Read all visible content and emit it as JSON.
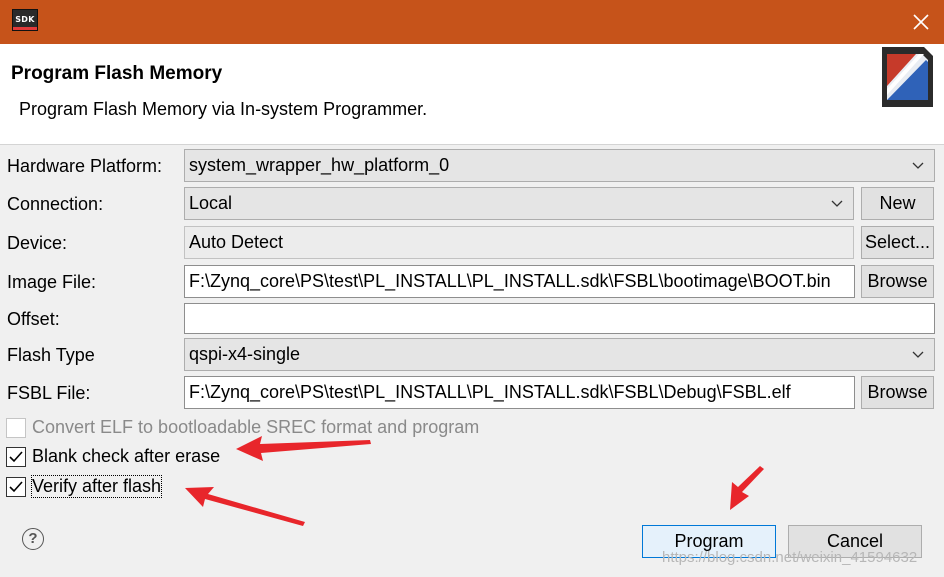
{
  "window": {
    "app_icon_text": "SDK",
    "close_icon": "close-icon",
    "title_bar_color": "#c6531a"
  },
  "header": {
    "title": "Program Flash Memory",
    "subtitle": "Program Flash Memory via In-system Programmer.",
    "logo_icon": "sdk-flash-logo-icon"
  },
  "form": {
    "hardware_platform": {
      "label": "Hardware Platform:",
      "value": "system_wrapper_hw_platform_0"
    },
    "connection": {
      "label": "Connection:",
      "value": "Local",
      "button": "New"
    },
    "device": {
      "label": "Device:",
      "value": "Auto Detect",
      "button": "Select..."
    },
    "image_file": {
      "label": "Image File:",
      "value": "F:\\Zynq_core\\PS\\test\\PL_INSTALL\\PL_INSTALL.sdk\\FSBL\\bootimage\\BOOT.bin",
      "button": "Browse"
    },
    "offset": {
      "label": "Offset:",
      "value": ""
    },
    "flash_type": {
      "label": "Flash Type",
      "value": "qspi-x4-single"
    },
    "fsbl_file": {
      "label": "FSBL File:",
      "value": "F:\\Zynq_core\\PS\\test\\PL_INSTALL\\PL_INSTALL.sdk\\FSBL\\Debug\\FSBL.elf",
      "button": "Browse"
    }
  },
  "options": {
    "convert_elf": {
      "label": "Convert ELF to bootloadable SREC format and program",
      "checked": false,
      "enabled": false
    },
    "blank_check": {
      "label": "Blank check after erase",
      "checked": true,
      "enabled": true
    },
    "verify": {
      "label": "Verify after flash",
      "checked": true,
      "enabled": true
    }
  },
  "footer": {
    "help": "?",
    "program_label": "Program",
    "cancel_label": "Cancel"
  },
  "annotation": {
    "arrow_color": "#e8262b"
  },
  "watermark": "https://blog.csdn.net/weixin_41594632"
}
